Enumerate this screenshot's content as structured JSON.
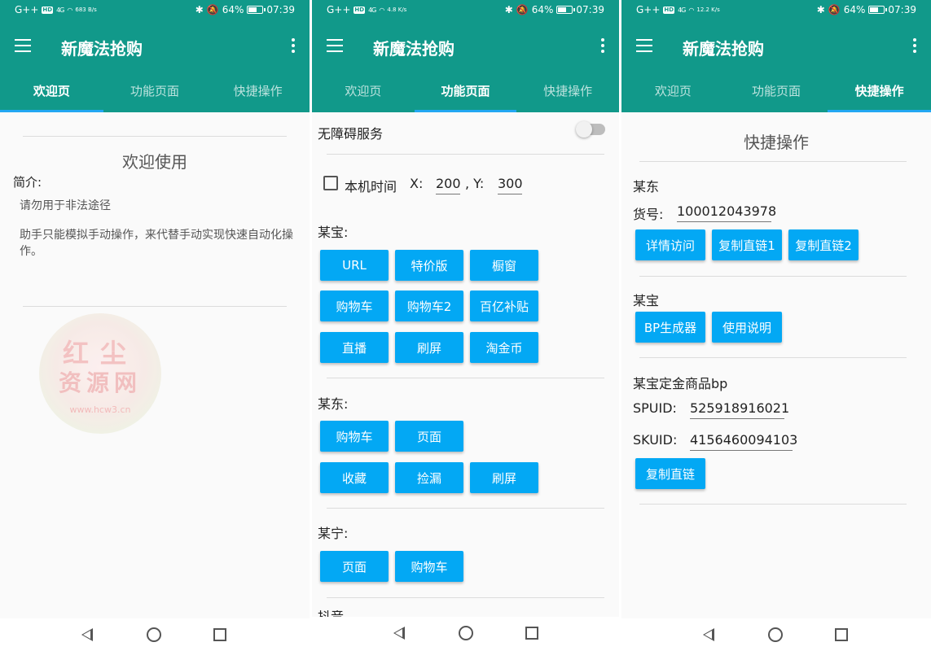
{
  "app": {
    "title": "新魔法抢购",
    "tabs": [
      "欢迎页",
      "功能页面",
      "快捷操作"
    ]
  },
  "status": {
    "network": "G++",
    "hd": "HD",
    "signal": "4G",
    "speeds": [
      "683 B/s",
      "4.8 K/s",
      "12.2 K/s"
    ],
    "battery": "64%",
    "time": "07:39"
  },
  "welcome": {
    "heading": "欢迎使用",
    "intro_label": "简介:",
    "line1": "请勿用于非法途径",
    "line2": "助手只能模拟手动操作，来代替手动实现快速自动化操作。",
    "watermark": {
      "line1": "红尘",
      "line2": "资源网",
      "url": "www.hcw3.cn"
    }
  },
  "features": {
    "accessibility_label": "无障碍服务",
    "accessibility_on": false,
    "local_time_label": "本机时间",
    "local_time_checked": false,
    "x_label": "X:",
    "x_value": "200",
    "comma_y_label": ",  Y:",
    "y_value": "300",
    "sections": [
      {
        "title": "某宝:",
        "buttons": [
          "URL",
          "特价版",
          "橱窗",
          "购物车",
          "购物车2",
          "百亿补贴",
          "直播",
          "刷屏",
          "淘金币"
        ]
      },
      {
        "title": "某东:",
        "buttons": [
          "购物车",
          "页面",
          "收藏",
          "捡漏",
          "刷屏"
        ]
      },
      {
        "title": "某宁:",
        "buttons": [
          "页面",
          "购物车"
        ]
      }
    ],
    "cut_off_title": "抖音"
  },
  "quick": {
    "heading": "快捷操作",
    "jd_title": "某东",
    "goods_label": "货号:",
    "goods_value": "100012043978",
    "jd_buttons": [
      "详情访问",
      "复制直链1",
      "复制直链2"
    ],
    "tb_title": "某宝",
    "tb_buttons": [
      "BP生成器",
      "使用说明"
    ],
    "deposit_title": "某宝定金商品bp",
    "spuid_label": "SPUID:",
    "spuid_value": "525918916021",
    "skuid_label": "SKUID:",
    "skuid_value": "4156460094103",
    "copy_button": "复制直链"
  },
  "colors": {
    "primary": "#11998a",
    "accent": "#03a8f4",
    "indicator": "#23a7f2"
  }
}
